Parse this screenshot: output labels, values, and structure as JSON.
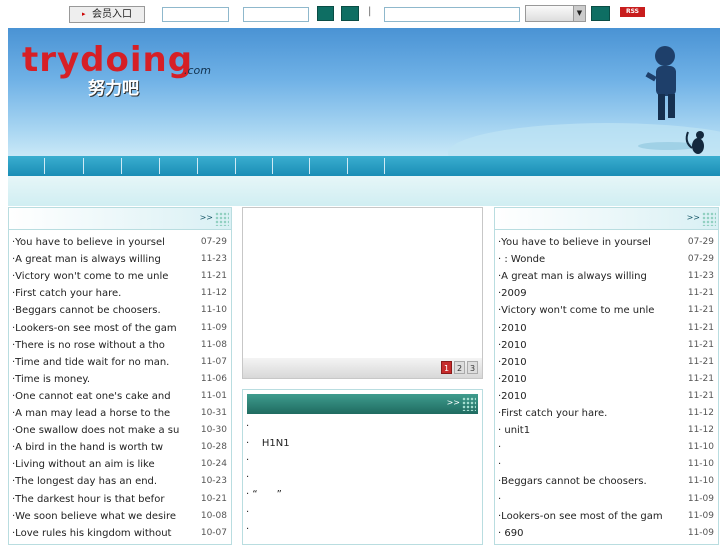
{
  "topbar": {
    "member_login": "会员入口",
    "separator": "|"
  },
  "logo": {
    "brand": "trydoing",
    "suffix": ".com",
    "tagline": "努力吧"
  },
  "rss": {
    "label": "RSS"
  },
  "left_list": {
    "more": ">>",
    "items": [
      {
        "title": "·You have to believe in yoursel",
        "date": "07-29"
      },
      {
        "title": "·A great man is always willing",
        "date": "11-23"
      },
      {
        "title": "·Victory won't come to me unle",
        "date": "11-21"
      },
      {
        "title": "·First catch your hare.",
        "date": "11-12"
      },
      {
        "title": "·Beggars cannot be choosers.",
        "date": "11-10"
      },
      {
        "title": "·Lookers-on see most of the gam",
        "date": "11-09"
      },
      {
        "title": "·There is no rose without a tho",
        "date": "11-08"
      },
      {
        "title": "·Time and tide wait for no man.",
        "date": "11-07"
      },
      {
        "title": "·Time is money.",
        "date": "11-06"
      },
      {
        "title": "·One cannot eat one's cake and",
        "date": "11-01"
      },
      {
        "title": "·A man may lead a horse to the",
        "date": "10-31"
      },
      {
        "title": "·One swallow does not make a su",
        "date": "10-30"
      },
      {
        "title": "·A bird in the hand is worth tw",
        "date": "10-28"
      },
      {
        "title": "·Living without an aim is like",
        "date": "10-24"
      },
      {
        "title": "·The longest day has an end.",
        "date": "10-23"
      },
      {
        "title": "·The darkest hour is that befor",
        "date": "10-21"
      },
      {
        "title": "·We soon believe what we desire",
        "date": "10-08"
      },
      {
        "title": "·Love rules his kingdom without",
        "date": "10-07"
      }
    ]
  },
  "slideshow": {
    "pages": [
      "1",
      "2",
      "3"
    ]
  },
  "center_list": {
    "more": ">>",
    "items": [
      "·",
      "·    H1N1",
      "·",
      "·",
      "· “      ”",
      "·",
      "·"
    ]
  },
  "right_list": {
    "more": ">>",
    "items": [
      {
        "title": "·You have to believe in yoursel",
        "date": "07-29"
      },
      {
        "title": "·     :        Wonde",
        "date": "07-29"
      },
      {
        "title": "·A great man is always willing",
        "date": "11-23"
      },
      {
        "title": "·2009",
        "date": "11-21"
      },
      {
        "title": "·Victory won't come to me unle",
        "date": "11-21"
      },
      {
        "title": "·2010",
        "date": "11-21"
      },
      {
        "title": "·2010",
        "date": "11-21"
      },
      {
        "title": "·2010",
        "date": "11-21"
      },
      {
        "title": "·2010",
        "date": "11-21"
      },
      {
        "title": "·2010",
        "date": "11-21"
      },
      {
        "title": "·First catch your hare.",
        "date": "11-12"
      },
      {
        "title": "·       unit1",
        "date": "11-12"
      },
      {
        "title": "·",
        "date": "11-10"
      },
      {
        "title": "·",
        "date": "11-10"
      },
      {
        "title": "·Beggars cannot be choosers.",
        "date": "11-10"
      },
      {
        "title": "·",
        "date": "11-09"
      },
      {
        "title": "·Lookers-on see most of the gam",
        "date": "11-09"
      },
      {
        "title": "·      690",
        "date": "11-09"
      }
    ]
  }
}
